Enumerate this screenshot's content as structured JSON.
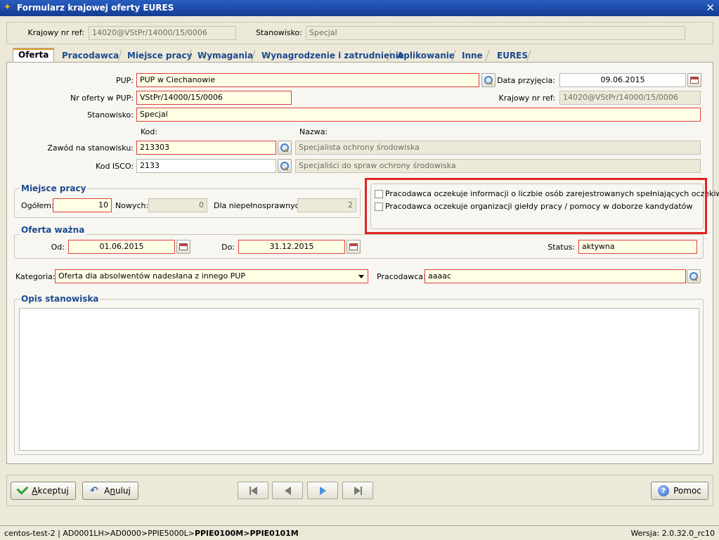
{
  "window": {
    "title": "Formularz krajowej oferty EURES",
    "icon": "app-icon",
    "close": "✕"
  },
  "header": {
    "ref_label": "Krajowy nr ref:",
    "ref_value": "14020@VStPr/14000/15/0006",
    "position_label": "Stanowisko:",
    "position_value": "Specjal"
  },
  "tabs": [
    {
      "label": "Oferta",
      "active": true
    },
    {
      "label": "Pracodawca"
    },
    {
      "label": "Miejsce pracy"
    },
    {
      "label": "Wymagania"
    },
    {
      "label": "Wynagrodzenie i zatrudnienie"
    },
    {
      "label": "Aplikowanie"
    },
    {
      "label": "Inne"
    },
    {
      "label": "EURES"
    }
  ],
  "form": {
    "pup_label": "PUP:",
    "pup_value": "PUP w Ciechanowie",
    "date_label": "Data przyjęcia:",
    "date_value": "09.06.2015",
    "offer_no_label": "Nr oferty w PUP:",
    "offer_no_value": "VStPr/14000/15/0006",
    "nat_ref_label": "Krajowy nr ref:",
    "nat_ref_value": "14020@VStPr/14000/15/0006",
    "position_label": "Stanowisko:",
    "position_value": "Specjal",
    "code_header": "Kod:",
    "name_header": "Nazwa:",
    "occupation_label": "Zawód na stanowisku:",
    "occupation_code": "213303",
    "occupation_name": "Specjalista ochrony środowiska",
    "isco_label": "Kod ISCO:",
    "isco_code": "2133",
    "isco_name": "Specjaliści do spraw ochrony środowiska"
  },
  "workplace": {
    "title": "Miejsce pracy",
    "total_label": "Ogółem:",
    "total_value": "10",
    "new_label": "Nowych:",
    "new_value": "0",
    "disabled_label": "Dla niepełnosprawnych:",
    "disabled_value": "2"
  },
  "checkboxes": [
    {
      "label": "Pracodawca oczekuje informacji o liczbie osób zarejestrowanych spełniających oczekiwania",
      "checked": false
    },
    {
      "label": "Pracodawca oczekuje organizacji giełdy pracy / pomocy w doborze kandydatów",
      "checked": false
    }
  ],
  "validity": {
    "title": "Oferta ważna",
    "from_label": "Od:",
    "from_value": "01.06.2015",
    "to_label": "Do:",
    "to_value": "31.12.2015",
    "status_label": "Status:",
    "status_value": "aktywna"
  },
  "category": {
    "label": "Kategoria:",
    "value": "Oferta dla absolwentów nadesłana z innego PUP",
    "employer_label": "Pracodawca:",
    "employer_value": "aaaac"
  },
  "description": {
    "title": "Opis stanowiska",
    "value": ""
  },
  "buttons": {
    "accept_pre": "A",
    "accept_rest": "kceptuj",
    "cancel_pre": "A",
    "cancel_u": "n",
    "cancel_rest": "uluj",
    "help": "Pomoc"
  },
  "statusbar": {
    "path_plain": "centos-test-2 | AD0001LH>AD0000>PPIE5000L>",
    "path_bold": "PPIE0100M>PPIE0101M",
    "version": "Wersja: 2.0.32.0_rc10"
  },
  "colors": {
    "title_bar": "#1b49a6",
    "required_bg": "#ffffe6",
    "required_border": "#e04040",
    "highlight": "#e02424",
    "tab_text": "#1c4a8f"
  }
}
